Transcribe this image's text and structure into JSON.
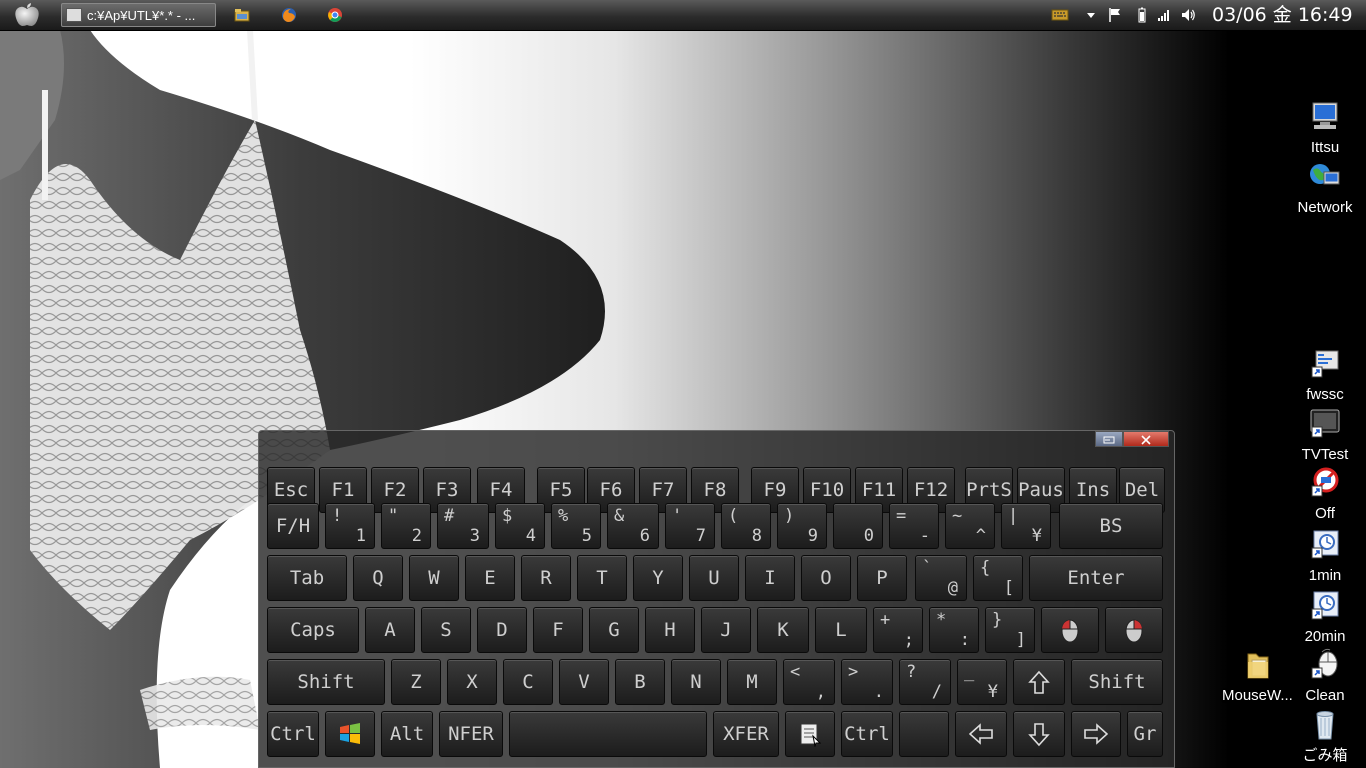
{
  "taskbar": {
    "task_title": "c:¥Ap¥UTL¥*.* - ...",
    "quick_launch": [
      "folder-icon",
      "firefox-icon",
      "chrome-icon"
    ],
    "tray_icons": [
      "keyboard-icon",
      "tray-arrow-icon",
      "flag-icon",
      "battery-icon",
      "signal-icon",
      "volume-icon"
    ],
    "clock": "03/06 金 16:49"
  },
  "desktop_icons": [
    {
      "label": "Ittsu",
      "icon": "computer-icon"
    },
    {
      "label": "Network",
      "icon": "network-icon"
    },
    {
      "label": "fwssc",
      "icon": "shortcut-icon"
    },
    {
      "label": "TVTest",
      "icon": "tv-icon"
    },
    {
      "label": "Off",
      "icon": "power-off-icon"
    },
    {
      "label": "1min",
      "icon": "timer-icon"
    },
    {
      "label": "20min",
      "icon": "timer-icon"
    },
    {
      "label": "MouseW...",
      "icon": "folder-icon"
    },
    {
      "label": "Clean",
      "icon": "mouse-icon"
    },
    {
      "label": "ごみ箱",
      "icon": "recycle-bin-icon"
    }
  ],
  "keyboard": {
    "rows": [
      [
        {
          "label": "Esc"
        },
        {
          "label": "F1"
        },
        {
          "label": "F2"
        },
        {
          "label": "F3"
        },
        {
          "label": "F4"
        },
        {
          "label": "F5"
        },
        {
          "label": "F6"
        },
        {
          "label": "F7"
        },
        {
          "label": "F8"
        },
        {
          "label": "F9"
        },
        {
          "label": "F10"
        },
        {
          "label": "F11"
        },
        {
          "label": "F12"
        },
        {
          "label": "PrtS"
        },
        {
          "label": "Paus"
        },
        {
          "label": "Ins"
        },
        {
          "label": "Del"
        }
      ],
      [
        {
          "label": "F/H"
        },
        {
          "top": "!",
          "bot": "1"
        },
        {
          "top": "\"",
          "bot": "2"
        },
        {
          "top": "#",
          "bot": "3"
        },
        {
          "top": "$",
          "bot": "4"
        },
        {
          "top": "%",
          "bot": "5"
        },
        {
          "top": "&",
          "bot": "6"
        },
        {
          "top": "'",
          "bot": "7"
        },
        {
          "top": "(",
          "bot": "8"
        },
        {
          "top": ")",
          "bot": "9"
        },
        {
          "top": "",
          "bot": "0"
        },
        {
          "top": "=",
          "bot": "-"
        },
        {
          "top": "~",
          "bot": "^"
        },
        {
          "top": "|",
          "bot": "¥"
        },
        {
          "label": "BS"
        }
      ],
      [
        {
          "label": "Tab"
        },
        {
          "label": "Q"
        },
        {
          "label": "W"
        },
        {
          "label": "E"
        },
        {
          "label": "R"
        },
        {
          "label": "T"
        },
        {
          "label": "Y"
        },
        {
          "label": "U"
        },
        {
          "label": "I"
        },
        {
          "label": "O"
        },
        {
          "label": "P"
        },
        {
          "top": "`",
          "bot": "@"
        },
        {
          "top": "{",
          "bot": "["
        },
        {
          "label": "Enter"
        }
      ],
      [
        {
          "label": "Caps"
        },
        {
          "label": "A"
        },
        {
          "label": "S"
        },
        {
          "label": "D"
        },
        {
          "label": "F"
        },
        {
          "label": "G"
        },
        {
          "label": "H"
        },
        {
          "label": "J"
        },
        {
          "label": "K"
        },
        {
          "label": "L"
        },
        {
          "top": "+",
          "bot": ";"
        },
        {
          "top": "*",
          "bot": ":"
        },
        {
          "top": "}",
          "bot": "]"
        },
        {
          "icon": "mouse-left-click-icon"
        },
        {
          "icon": "mouse-right-click-icon"
        }
      ],
      [
        {
          "label": "Shift"
        },
        {
          "label": "Z"
        },
        {
          "label": "X"
        },
        {
          "label": "C"
        },
        {
          "label": "V"
        },
        {
          "label": "B"
        },
        {
          "label": "N"
        },
        {
          "label": "M"
        },
        {
          "top": "<",
          "bot": ","
        },
        {
          "top": ">",
          "bot": "."
        },
        {
          "top": "?",
          "bot": "/"
        },
        {
          "top": "_",
          "bot": "¥"
        },
        {
          "icon": "arrow-up-icon"
        },
        {
          "label": "Shift"
        }
      ],
      [
        {
          "label": "Ctrl"
        },
        {
          "icon": "windows-logo-icon"
        },
        {
          "label": "Alt"
        },
        {
          "label": "NFER"
        },
        {
          "label": ""
        },
        {
          "label": "XFER"
        },
        {
          "icon": "menu-key-icon"
        },
        {
          "label": "Ctrl"
        },
        {
          "label": ""
        },
        {
          "icon": "arrow-left-icon"
        },
        {
          "icon": "arrow-down-icon"
        },
        {
          "icon": "arrow-right-icon"
        },
        {
          "label": "Gr"
        }
      ]
    ]
  }
}
